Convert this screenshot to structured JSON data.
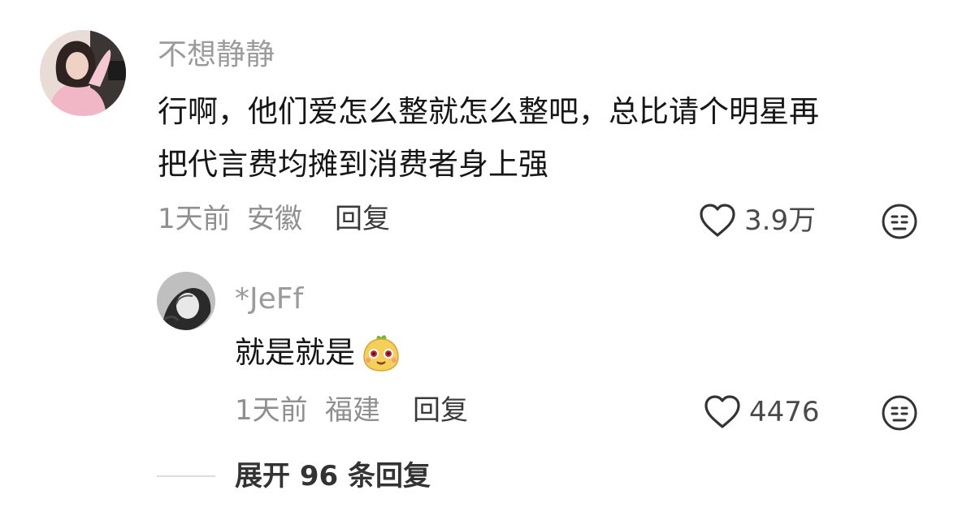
{
  "comment": {
    "username": "不想静静",
    "content_line1": "行啊，他们爱怎么整就怎么整吧，总比请个明星再",
    "content_line2": "把代言费均摊到消费者身上强",
    "time": "1天前",
    "location": "安徽",
    "reply_label": "回复",
    "like_count": "3.9万"
  },
  "reply": {
    "username": "*JeFf",
    "content": "就是就是",
    "time": "1天前",
    "location": "福建",
    "reply_label": "回复",
    "like_count": "4476"
  },
  "expand": {
    "label": "展开 96 条回复"
  },
  "icons": {
    "like": "heart-outline-icon",
    "dislike": "meh-face-icon",
    "emoji": "yellow-fruit-emoji-icon"
  }
}
